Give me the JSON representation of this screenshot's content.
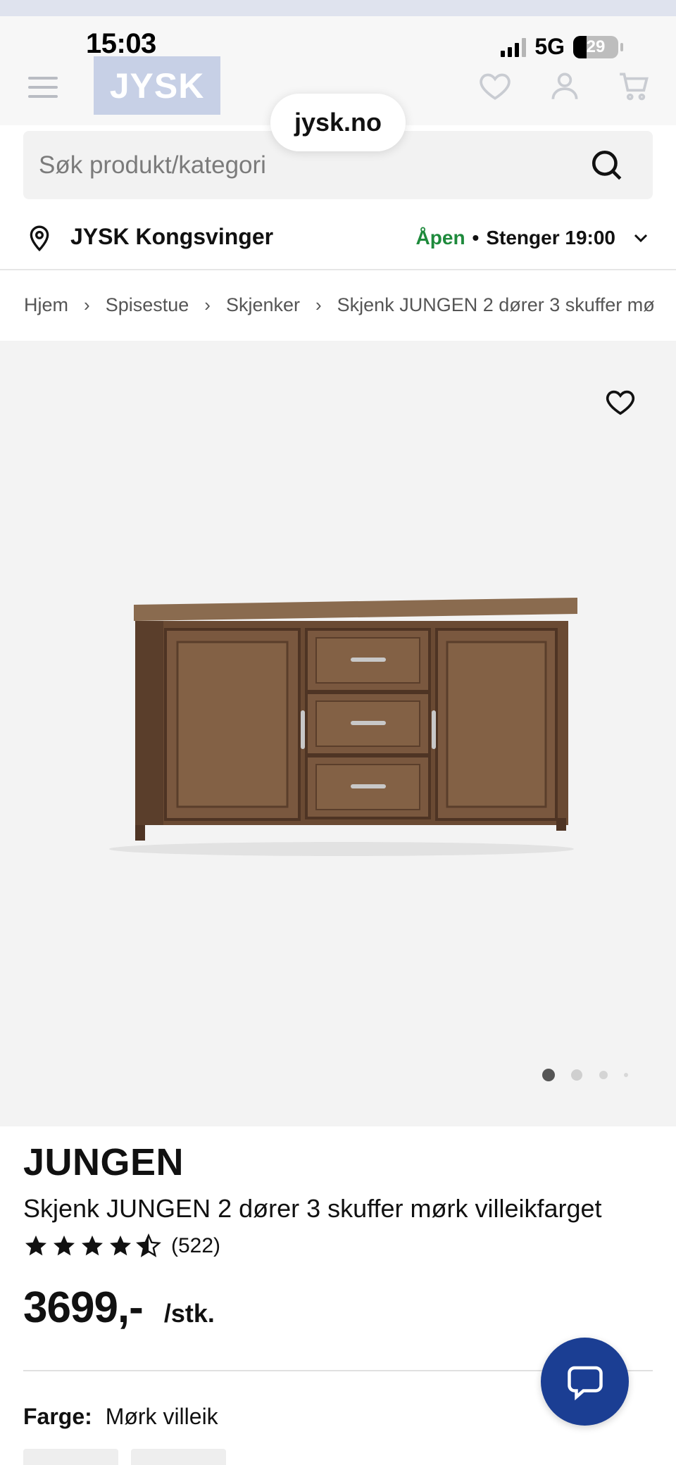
{
  "status_bar": {
    "time": "15:03",
    "network": "5G",
    "battery": "29",
    "battery_level_percent": 29
  },
  "header": {
    "logo_text": "JYSK",
    "url": "jysk.no",
    "icons": [
      "menu-icon",
      "heart-icon",
      "user-icon",
      "cart-icon"
    ]
  },
  "search": {
    "placeholder": "Søk produkt/kategori"
  },
  "store": {
    "name": "JYSK Kongsvinger",
    "status_open": "Åpen",
    "separator": "•",
    "closing": "Stenger 19:00"
  },
  "breadcrumb": {
    "items": [
      "Hjem",
      "Spisestue",
      "Skjenker",
      "Skjenk JUNGEN 2 dører 3 skuffer mø"
    ],
    "separator": "›"
  },
  "gallery": {
    "image_count": 4,
    "active_index": 0
  },
  "product": {
    "brand": "JUNGEN",
    "name": "Skjenk JUNGEN 2 dører 3 skuffer mørk villeikfarget",
    "rating_value": 4.5,
    "rating_max": 5,
    "review_count": "(522)",
    "price": "3699,-",
    "unit": "/stk.",
    "color_label": "Farge:",
    "color_value": "Mørk villeik"
  },
  "colors": {
    "accent": "#1b3e93",
    "open_green": "#1e8a3c",
    "logo_bg": "#c7d0e6"
  }
}
